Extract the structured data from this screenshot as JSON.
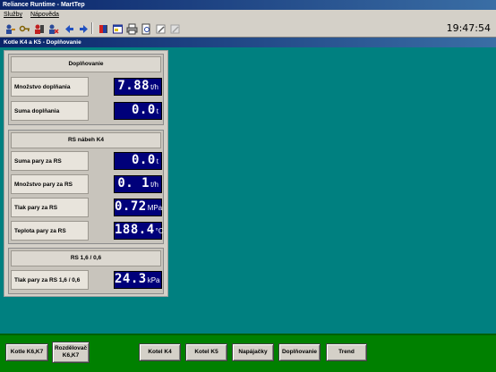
{
  "app": {
    "title": "Reliance Runtime - MartTep",
    "menu": [
      "Služby",
      "Nápověda"
    ],
    "clock": "19:47:54",
    "toolbar_icons": [
      "login-icon",
      "key-icon",
      "user-logout-icon",
      "user-x-icon",
      "back-arrow-icon",
      "forward-arrow-icon",
      "book-icon",
      "window-icon",
      "print-icon",
      "print-preview-icon",
      "edit-icon",
      "edit-disabled-icon"
    ]
  },
  "window": {
    "title": "Kotle K4 a K5 - Doplňovanie"
  },
  "groups": {
    "dopl": {
      "title": "Doplňovanie",
      "rows": [
        {
          "label": "Množstvo doplňania",
          "value": "7.88",
          "unit": "t/h"
        },
        {
          "label": "Suma doplňania",
          "value": "0.0",
          "unit": "t"
        }
      ]
    },
    "rs": {
      "title": "RS nábeh K4",
      "rows": [
        {
          "label": "Suma pary za RS",
          "value": "0.0",
          "unit": "t"
        },
        {
          "label": "Množstvo pary za RS",
          "value": "0. 1",
          "unit": "t/h"
        },
        {
          "label": "Tlak pary za RS",
          "value": "0.72",
          "unit": "MPa"
        },
        {
          "label": "Teplota pary za RS",
          "value": "188.4",
          "unit": "°C"
        }
      ]
    },
    "rs16": {
      "title": "RS 1,6 / 0,6",
      "rows": [
        {
          "label": "Tlak pary za RS 1,6 / 0,6",
          "value": "24.3",
          "unit": "kPa"
        }
      ]
    }
  },
  "nav": {
    "kotle_k6k7": "Kotle K6,K7",
    "rozdelovac": "Rozdělovač K6,K7",
    "kotel_k4": "Kotel K4",
    "kotel_k5": "Kotel K5",
    "napajacky": "Napájačky",
    "doplnovanie": "Doplňovanie",
    "trend": "Trend"
  },
  "colors": {
    "background": "#008080",
    "value_bg": "#00007a",
    "bottom_bar": "#008000",
    "titlebar": "#0a246a"
  }
}
